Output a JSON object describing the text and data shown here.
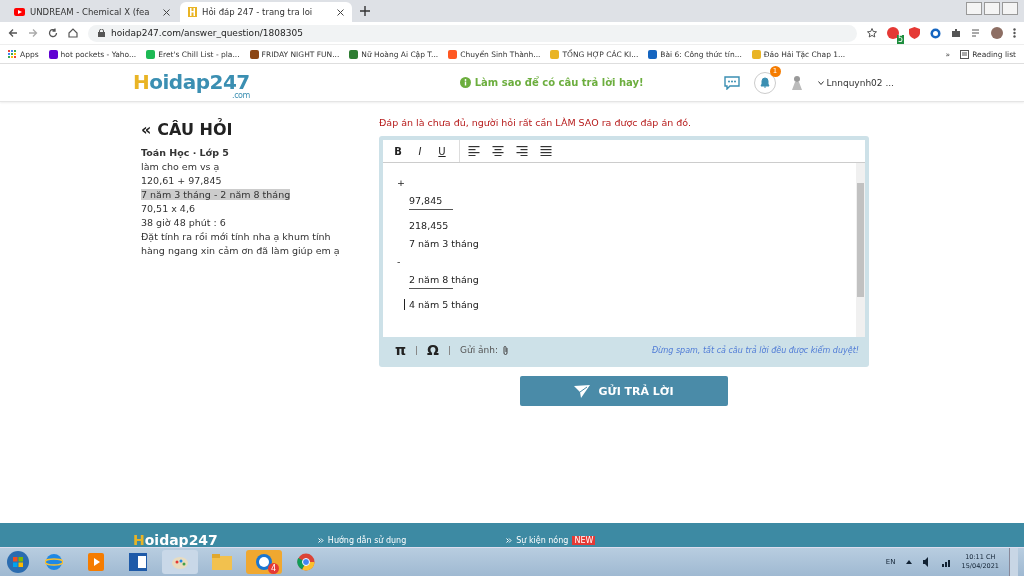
{
  "browser": {
    "tabs": [
      {
        "title": "UNDREAM - Chemical X (fea",
        "selected": false,
        "kind": "video"
      },
      {
        "title": "Hỏi đáp 247 - trang tra loi",
        "selected": true,
        "kind": "site"
      }
    ],
    "address": "hoidap247.com/answer_question/1808305",
    "extension_badge": "5",
    "bookmarks": [
      "Apps",
      "hot pockets - Yaho...",
      "Eret's Chill List - pla...",
      "FRIDAY NIGHT FUN...",
      "Nữ Hoàng Ai Cập T...",
      "Chuyển Sinh Thành...",
      "TỔNG HỢP CÁC KI...",
      "Bài 6: Công thức tín...",
      "Đảo Hải Tặc Chap 1..."
    ],
    "more": "»",
    "reading_list": "Reading list"
  },
  "site": {
    "logo": "Hoidap247",
    "logo_sub": ".com",
    "tip": "Làm sao để có câu trả lời hay!",
    "notification_count": "1",
    "username": "Lnnquynh02 ..."
  },
  "question": {
    "back": "«",
    "heading": "CÂU HỎI",
    "subject": "Toán Học · Lớp 5",
    "lines": [
      {
        "text": "làm cho em vs ạ",
        "highlighted": false
      },
      {
        "text": "120,61 + 97,845",
        "highlighted": false
      },
      {
        "text": "7 năm 3 tháng - 2 năm 8 tháng",
        "highlighted": true
      },
      {
        "text": "70,51 x 4,6",
        "highlighted": false
      },
      {
        "text": "38 giờ 48 phút : 6",
        "highlighted": false
      },
      {
        "text": "Đặt tính ra rồi mới tính nha ạ khum tính hàng ngang xin cảm ơn đã làm giúp em ạ",
        "highlighted": false
      }
    ]
  },
  "answer": {
    "warning": "Đáp án là chưa đủ, người hỏi rất cần LÀM SAO ra được đáp án đó.",
    "format_buttons": [
      "B",
      "I",
      "U"
    ],
    "lines": [
      {
        "kind": "op",
        "text": "+"
      },
      {
        "kind": "text",
        "text": "97,845"
      },
      {
        "kind": "rule"
      },
      {
        "kind": "text",
        "text": "218,455"
      },
      {
        "kind": "text",
        "text": "7 năm 3 tháng"
      },
      {
        "kind": "op",
        "text": "-"
      },
      {
        "kind": "text",
        "text": "2 năm 8 tháng"
      },
      {
        "kind": "rule"
      },
      {
        "kind": "text",
        "text": "4 năm 5 tháng"
      }
    ],
    "pi": "π",
    "omega": "Ω",
    "attach_label": "Gửi ảnh:",
    "notice": "Đừng spam, tất cả câu trả lời đều được kiểm duyệt!",
    "submit": "GỬI TRẢ LỜI"
  },
  "footer": {
    "logo": "Hoidap247",
    "links": [
      "Hướng dẫn sử dụng",
      "Sự kiện nóng"
    ],
    "badge": "NEW"
  },
  "taskbar": {
    "chat_badge": "4",
    "language": "EN",
    "time": "10:11 CH",
    "date": "15/04/2021"
  }
}
